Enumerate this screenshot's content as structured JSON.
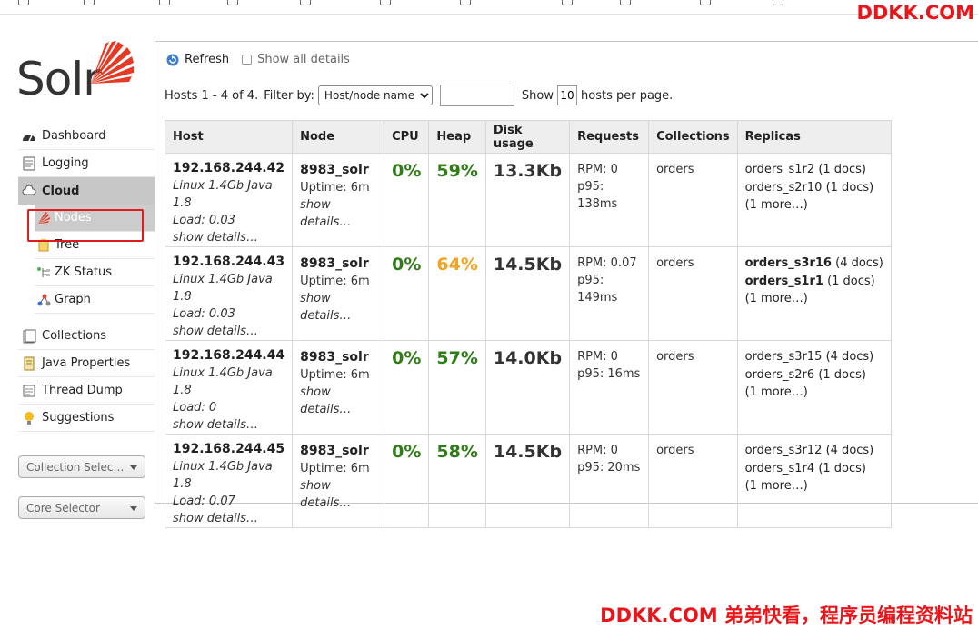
{
  "watermark": {
    "top": "DDKK.COM",
    "bottom": "DDKK.COM 弟弟快看，程序员编程资料站"
  },
  "logo": {
    "text": "Solr",
    "accent_color": "#e63a24"
  },
  "sidebar": {
    "items": [
      {
        "label": "Dashboard",
        "icon": "dashboard-icon"
      },
      {
        "label": "Logging",
        "icon": "logging-icon"
      },
      {
        "label": "Cloud",
        "icon": "cloud-icon"
      }
    ],
    "cloud_sub": [
      {
        "label": "Nodes",
        "icon": "solr-sun-icon",
        "active": true
      },
      {
        "label": "Tree",
        "icon": "tree-icon"
      },
      {
        "label": "ZK Status",
        "icon": "zk-status-icon"
      },
      {
        "label": "Graph",
        "icon": "graph-icon"
      }
    ],
    "items2": [
      {
        "label": "Collections",
        "icon": "collections-icon"
      },
      {
        "label": "Java Properties",
        "icon": "java-icon"
      },
      {
        "label": "Thread Dump",
        "icon": "thread-dump-icon"
      },
      {
        "label": "Suggestions",
        "icon": "lightbulb-icon"
      }
    ],
    "collection_selector": "Collection Selec…",
    "core_selector": "Core Selector"
  },
  "toolbar": {
    "refresh": "Refresh",
    "show_all": "Show all details"
  },
  "filter": {
    "summary": "Hosts 1 - 4 of 4.",
    "filter_by": "Filter by:",
    "filter_option": "Host/node name",
    "show": "Show",
    "per_page": "10",
    "hosts_per_page": "hosts per page."
  },
  "table": {
    "headers": [
      "Host",
      "Node",
      "CPU",
      "Heap",
      "Disk usage",
      "Requests",
      "Collections",
      "Replicas"
    ],
    "rows": [
      {
        "host": "192.168.244.42",
        "os": "Linux 1.4Gb Java 1.8",
        "load": "Load: 0.03",
        "show": "show details…",
        "node": "8983_solr",
        "uptime": "Uptime: 6m",
        "node_show": "show details…",
        "cpu": "0%",
        "heap": "59%",
        "heap_color": "green",
        "disk": "13.3Kb",
        "rpm": "RPM: 0",
        "p95": "p95: 138ms",
        "collections": "orders",
        "replicas": [
          {
            "name": "orders_s1r2",
            "docs": " (1 docs)",
            "bold": false
          },
          {
            "name": "orders_s2r10",
            "docs": " (1 docs)",
            "bold": false
          }
        ],
        "more": "(1 more…)"
      },
      {
        "host": "192.168.244.43",
        "os": "Linux 1.4Gb Java 1.8",
        "load": "Load: 0.03",
        "show": "show details…",
        "node": "8983_solr",
        "uptime": "Uptime: 6m",
        "node_show": "show details…",
        "cpu": "0%",
        "heap": "64%",
        "heap_color": "orange",
        "disk": "14.5Kb",
        "rpm": "RPM: 0.07",
        "p95": "p95: 149ms",
        "collections": "orders",
        "replicas": [
          {
            "name": "orders_s3r16",
            "docs": " (4 docs)",
            "bold": true
          },
          {
            "name": "orders_s1r1",
            "docs": " (1 docs)",
            "bold": true
          }
        ],
        "more": "(1 more…)"
      },
      {
        "host": "192.168.244.44",
        "os": "Linux 1.4Gb Java 1.8",
        "load": "Load: 0",
        "show": "show details…",
        "node": "8983_solr",
        "uptime": "Uptime: 6m",
        "node_show": "show details…",
        "cpu": "0%",
        "heap": "57%",
        "heap_color": "green",
        "disk": "14.0Kb",
        "rpm": "RPM: 0",
        "p95": "p95: 16ms",
        "collections": "orders",
        "replicas": [
          {
            "name": "orders_s3r15",
            "docs": " (4 docs)",
            "bold": false
          },
          {
            "name": "orders_s2r6",
            "docs": " (1 docs)",
            "bold": false
          }
        ],
        "more": "(1 more…)"
      },
      {
        "host": "192.168.244.45",
        "os": "Linux 1.4Gb Java 1.8",
        "load": "Load: 0.07",
        "show": "show details…",
        "node": "8983_solr",
        "uptime": "Uptime: 6m",
        "node_show": "show details…",
        "cpu": "0%",
        "heap": "58%",
        "heap_color": "green",
        "disk": "14.5Kb",
        "rpm": "RPM: 0",
        "p95": "p95: 20ms",
        "collections": "orders",
        "replicas": [
          {
            "name": "orders_s3r12",
            "docs": " (4 docs)",
            "bold": false
          },
          {
            "name": "orders_s1r4",
            "docs": " (1 docs)",
            "bold": false
          }
        ],
        "more": "(1 more…)"
      }
    ]
  }
}
